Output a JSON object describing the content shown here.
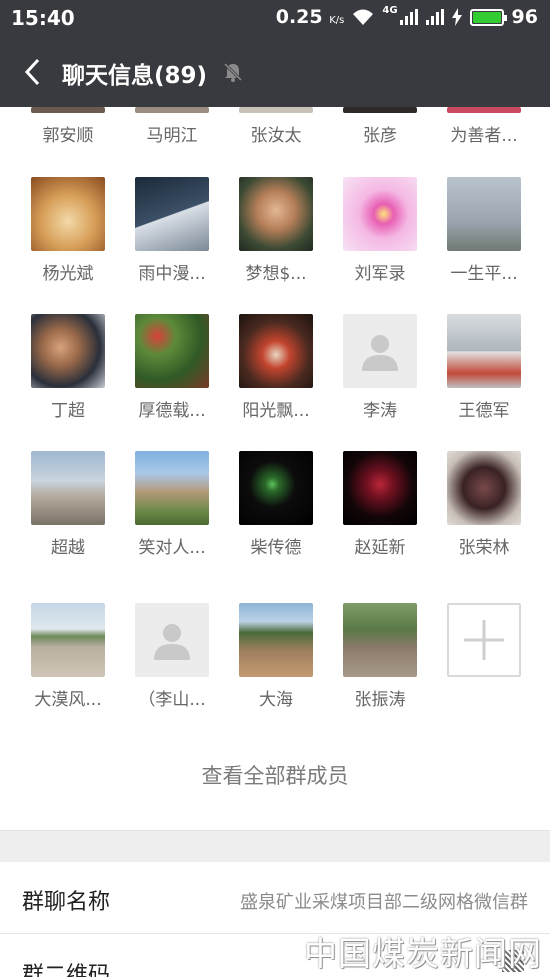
{
  "status_bar": {
    "time": "15:40",
    "speed": "0.25",
    "speed_unit": "K/s",
    "network": "4G",
    "battery": "96"
  },
  "nav": {
    "title": "聊天信息(89)"
  },
  "partial_members": [
    "郭安顺",
    "马明江",
    "张汝太",
    "张彦",
    "为善者..."
  ],
  "members": [
    [
      "杨光斌",
      "雨中漫...",
      "梦想$...",
      "刘军录",
      "一生平..."
    ],
    [
      "丁超",
      "厚德载...",
      "阳光飘...",
      "李涛",
      "王德军"
    ],
    [
      "超越",
      "笑对人...",
      "柴传德",
      "赵延新",
      "张荣林"
    ],
    [
      "大漠风...",
      "（李山...",
      "大海",
      "张振涛"
    ]
  ],
  "view_all": "查看全部群成员",
  "group_name": {
    "label": "群聊名称",
    "value": "盛泉矿业采煤项目部二级网格微信群"
  },
  "group_qr": {
    "label": "群二维码"
  },
  "watermark": "中国煤炭新闻网",
  "colors": {
    "nav_bg": "#393a3f",
    "battery": "#33cc33"
  }
}
